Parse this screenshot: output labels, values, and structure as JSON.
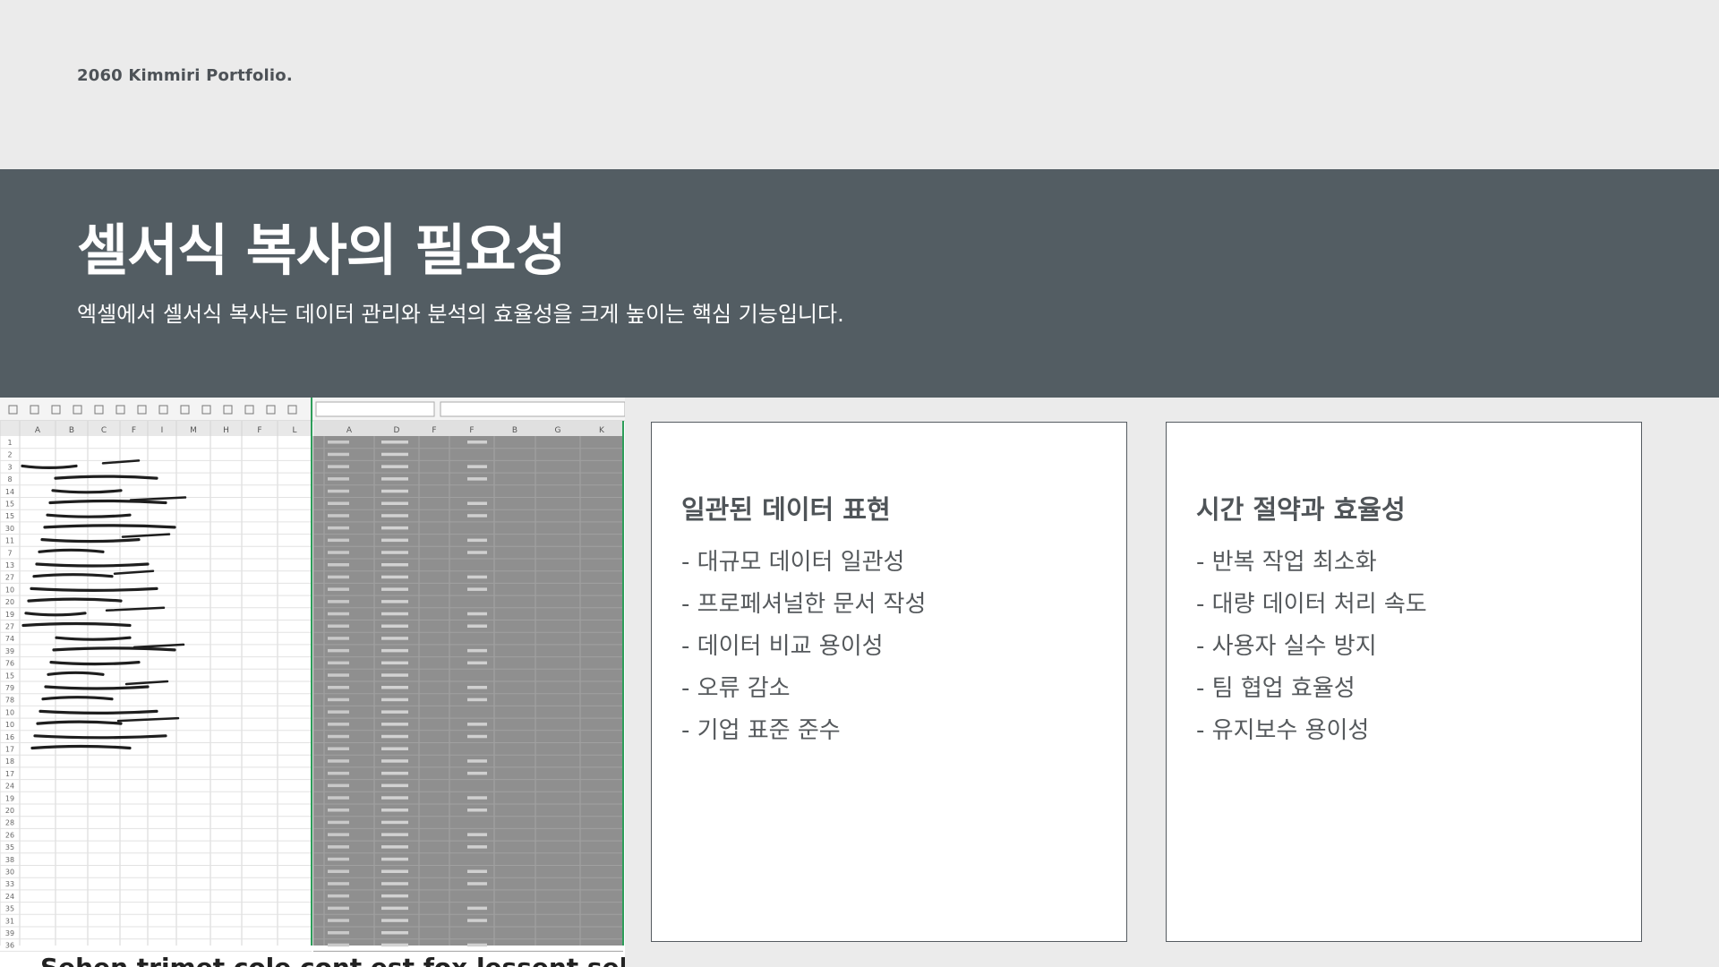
{
  "brand": "2060 Kimmiri Portfolio.",
  "banner": {
    "title": "셀서식 복사의 필요성",
    "subtitle": "엑셀에서 셀서식 복사는 데이터 관리와 분석의 효율성을 크게 높이는 핵심 기능입니다."
  },
  "screenshot": {
    "caption": "Sehen trimet cole cont est fox lessent sehee",
    "left_columns": [
      "A",
      "B",
      "C",
      "F",
      "I",
      "M",
      "H",
      "F",
      "L"
    ],
    "left_row_numbers": [
      "1",
      "2",
      "3",
      "8",
      "14",
      "15",
      "15",
      "30",
      "11",
      "7",
      "13",
      "27",
      "10",
      "20",
      "19",
      "27",
      "74",
      "39",
      "76",
      "15",
      "79",
      "78",
      "10",
      "10",
      "16",
      "17",
      "18",
      "17",
      "24",
      "19",
      "20",
      "28",
      "26",
      "35",
      "38",
      "30",
      "33",
      "24",
      "35",
      "31",
      "39",
      "36"
    ],
    "right_columns": [
      "A",
      "D",
      "F",
      "F",
      "B",
      "G",
      "K"
    ]
  },
  "cards": [
    {
      "title": "일관된 데이터 표현",
      "items": [
        "- 대규모 데이터 일관성",
        "- 프로페셔널한 문서 작성",
        "- 데이터 비교 용이성",
        "- 오류 감소",
        "- 기업 표준 준수"
      ]
    },
    {
      "title": "시간 절약과 효율성",
      "items": [
        "- 반복 작업 최소화",
        "- 대량 데이터 처리 속도",
        "- 사용자 실수 방지",
        "- 팀 협업 효율성",
        "- 유지보수 용이성"
      ]
    }
  ]
}
